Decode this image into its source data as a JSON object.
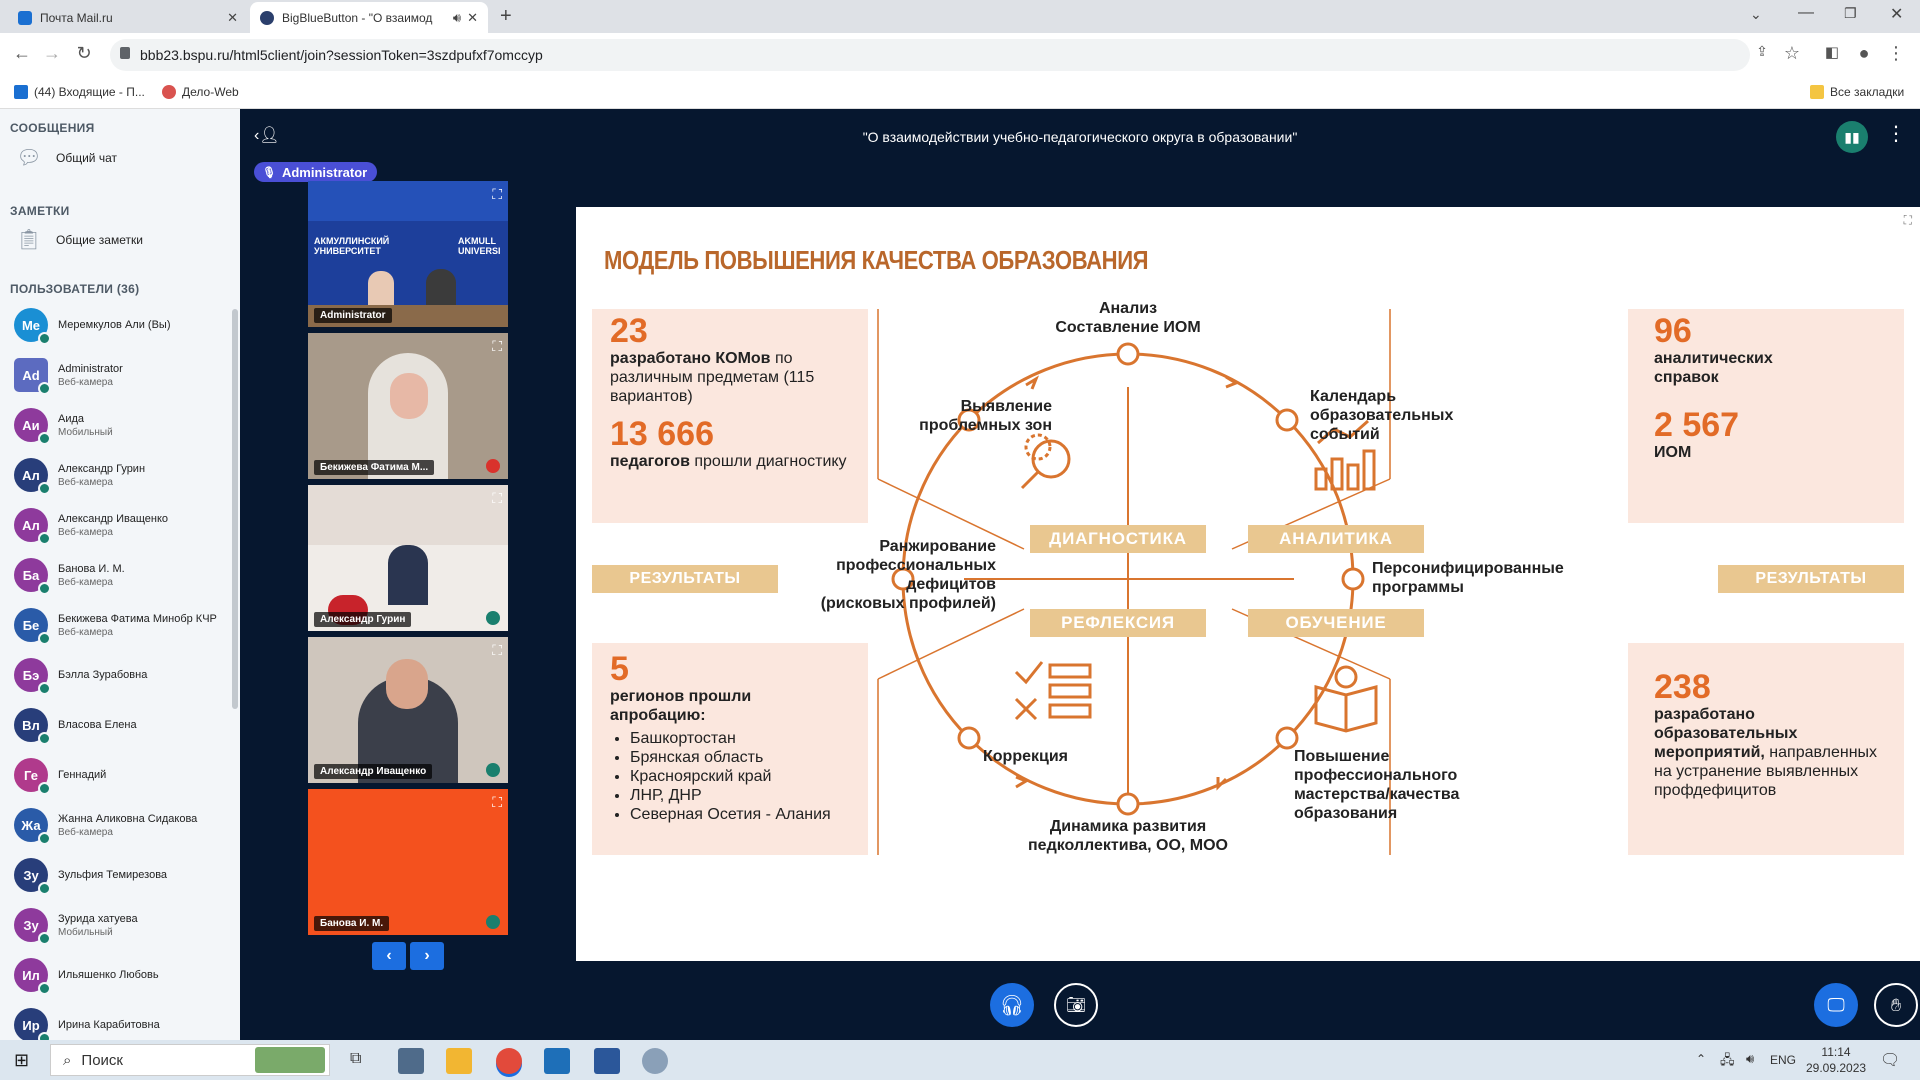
{
  "browser": {
    "tabs": [
      {
        "title": "Почта Mail.ru",
        "active": false
      },
      {
        "title": "BigBlueButton - \"О взаимод",
        "active": true
      }
    ],
    "new_tab": "+",
    "url": "bbb23.bspu.ru/html5client/join?sessionToken=3szdpufxf7omccyp",
    "bookmarks": [
      {
        "label": "(44) Входящие - П..."
      },
      {
        "label": "Дело-Web"
      }
    ],
    "all_bookmarks": "Все закладки"
  },
  "sidebar": {
    "messages_header": "СООБЩЕНИЯ",
    "public_chat": "Общий чат",
    "notes_header": "ЗАМЕТКИ",
    "shared_notes": "Общие заметки",
    "users_header": "ПОЛЬЗОВАТЕЛИ (36)",
    "users": [
      {
        "initials": "Ме",
        "name": "Меремкулов Али (Вы)",
        "status": "",
        "color": "#1a8fd4"
      },
      {
        "initials": "Ad",
        "name": "Administrator",
        "status": "Веб-камера",
        "color": "#5c6bc0"
      },
      {
        "initials": "Аи",
        "name": "Аида",
        "status": "Мобильный",
        "color": "#8e3a9c"
      },
      {
        "initials": "Ал",
        "name": "Александр Гурин",
        "status": "Веб-камера",
        "color": "#283e7a"
      },
      {
        "initials": "Ал",
        "name": "Александр Иващенко",
        "status": "Веб-камера",
        "color": "#8e3a9c"
      },
      {
        "initials": "Ба",
        "name": "Банова И. М.",
        "status": "Веб-камера",
        "color": "#8e3a9c"
      },
      {
        "initials": "Бе",
        "name": "Бекижева Фатима Минобр КЧР",
        "status": "Веб-камера",
        "color": "#2a5ba8"
      },
      {
        "initials": "Бэ",
        "name": "Бэлла Зурабовна",
        "status": "",
        "color": "#8e3a9c"
      },
      {
        "initials": "Вл",
        "name": "Власова Елена",
        "status": "",
        "color": "#283e7a"
      },
      {
        "initials": "Ге",
        "name": "Геннадий",
        "status": "",
        "color": "#b03a8c"
      },
      {
        "initials": "Жа",
        "name": "Жанна Аликовна Сидакова",
        "status": "Веб-камера",
        "color": "#2a5ba8"
      },
      {
        "initials": "Зу",
        "name": "Зульфия Темирезова",
        "status": "",
        "color": "#283e7a"
      },
      {
        "initials": "Зу",
        "name": "Зурида хатуева",
        "status": "Мобильный",
        "color": "#8e3a9c"
      },
      {
        "initials": "Ил",
        "name": "Ильяшенко Любовь",
        "status": "",
        "color": "#8e3a9c"
      },
      {
        "initials": "Ир",
        "name": "Ирина Карабитовна",
        "status": "",
        "color": "#283e7a"
      }
    ]
  },
  "meeting": {
    "title": "\"О взаимодействии учебно-педагогического округа в образовании\"",
    "presenter_badge": "Administrator",
    "videos": [
      {
        "label": "Administrator"
      },
      {
        "label": "Бекижева Фатима М..."
      },
      {
        "label": "Александр Гурин"
      },
      {
        "label": "Александр Иващенко"
      },
      {
        "label": "Банова И. М."
      }
    ],
    "video1_banner_left": "АКМУЛЛИНСКИЙ УНИВЕРСИТЕТ",
    "video1_banner_right": "AKMULL UNIVERSI"
  },
  "slide": {
    "title": "МОДЕЛЬ ПОВЫШЕНИЯ КАЧЕСТВА ОБРАЗОВАНИЯ",
    "left_top": {
      "num1": "23",
      "text1_bold": "разработано КОМов",
      "text1": " по различным предметам (115 вариантов)",
      "num2": "13 666",
      "text2_bold": "педагогов",
      "text2": " прошли диагностику"
    },
    "left_bottom": {
      "num": "5",
      "text_bold": "регионов прошли апробацию:",
      "regions": [
        "Башкортостан",
        "Брянская область",
        "Красноярский край",
        "ЛНР, ДНР",
        "Северная Осетия - Алания"
      ]
    },
    "right_top": {
      "num1": "96",
      "text1": "аналитических справок",
      "num2": "2 567",
      "text2": "ИОМ"
    },
    "right_bottom": {
      "num": "238",
      "text_bold": "разработано образовательных мероприятий,",
      "text": " направленных на устранение выявленных профдефицитов"
    },
    "results_left": "РЕЗУЛЬТАТЫ",
    "results_right": "РЕЗУЛЬТАТЫ",
    "quadrants": [
      "ДИАГНОСТИКА",
      "АНАЛИТИКА",
      "РЕФЛЕКСИЯ",
      "ОБУЧЕНИЕ"
    ],
    "cycle": {
      "top": "Анализ\nСоставление ИОМ",
      "top_left": "Выявление\nпроблемных зон",
      "top_right": "Календарь\nобразовательных\nсобытий",
      "left": "Ранжирование\nпрофессиональных\nдефицитов\n(рисковых профилей)",
      "right": "Персонифицированные\nпрограммы",
      "bottom_left": "Коррекция",
      "bottom_right": "Повышение\nпрофессионального\nмастерства/качества\nобразования",
      "bottom": "Динамика развития\nпедколлектива, ОО, МОО"
    },
    "accent_color": "#d9752f"
  },
  "taskbar": {
    "search": "Поиск",
    "lang": "ENG",
    "time": "11:14",
    "date": "29.09.2023"
  }
}
